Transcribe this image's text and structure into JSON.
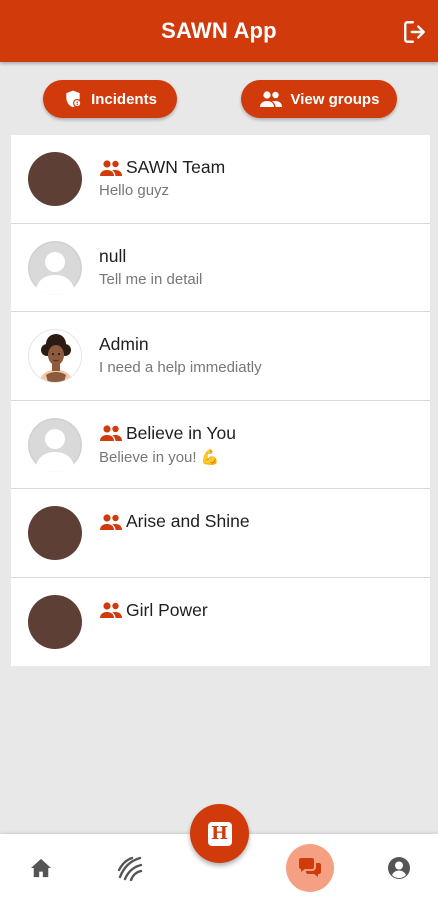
{
  "app": {
    "title": "SAWN App",
    "accent_color": "#d13a0a"
  },
  "header": {
    "logout_icon": "logout-icon"
  },
  "actions": {
    "incidents_label": "Incidents",
    "incidents_icon": "shield-alert-icon",
    "groups_label": "View groups",
    "groups_icon": "group-icon"
  },
  "chats": [
    {
      "name": "SAWN Team",
      "last_message": "Hello guyz",
      "is_group": true,
      "avatar": "brown-circle"
    },
    {
      "name": "null",
      "last_message": "Tell me in detail",
      "is_group": false,
      "avatar": "default-person"
    },
    {
      "name": "Admin",
      "last_message": "I need a help immediatly",
      "is_group": false,
      "avatar": "woman-portrait"
    },
    {
      "name": "Believe in You",
      "last_message": "Believe in you! 💪",
      "is_group": true,
      "avatar": "default-person"
    },
    {
      "name": "Arise and Shine",
      "last_message": "",
      "is_group": true,
      "avatar": "brown-circle"
    },
    {
      "name": "Girl Power",
      "last_message": "",
      "is_group": true,
      "avatar": "brown-circle"
    }
  ],
  "bottom_nav": {
    "items": [
      "home-icon",
      "waves-icon",
      "help-h-icon",
      "chat-icon",
      "account-icon"
    ],
    "fab_letter": "H",
    "active": "chat-icon"
  }
}
